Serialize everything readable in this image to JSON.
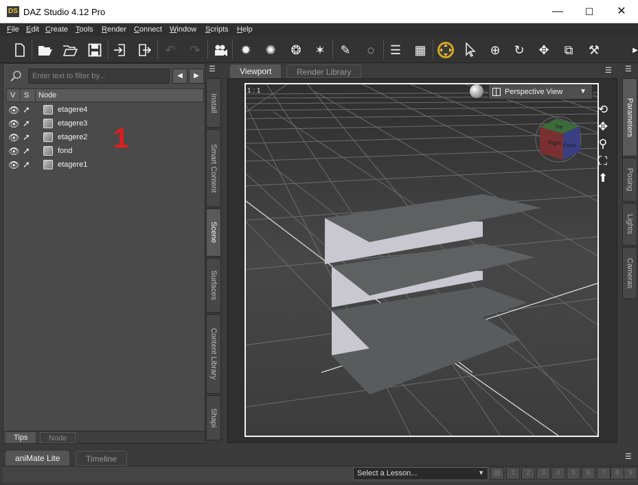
{
  "window": {
    "logo_text": "DS",
    "title": "DAZ Studio 4.12 Pro",
    "minimize": "—",
    "maximize": "☐",
    "close": "✕"
  },
  "menu": [
    "File",
    "Edit",
    "Create",
    "Tools",
    "Render",
    "Connect",
    "Window",
    "Scripts",
    "Help"
  ],
  "toolbar": {
    "icons": [
      "new-file-icon",
      "open-file-icon",
      "merge-file-icon",
      "save-icon",
      "import-icon",
      "export-icon",
      "undo-icon",
      "redo-icon",
      "camera-icon",
      "spotlight-icon",
      "point-light-icon",
      "distant-light-icon",
      "render-icon",
      "select-tool-icon",
      "node-select-icon",
      "universal-tool-icon",
      "rotate-tool-icon",
      "translate-tool-icon",
      "scale-tool-icon",
      "joint-editor-icon"
    ]
  },
  "scene_pane": {
    "filter_placeholder": "Enter text to filter by...",
    "columns": {
      "v": "V",
      "s": "S",
      "node": "Node"
    },
    "nodes": [
      "etagere4",
      "etagere3",
      "etagere2",
      "fond",
      "etagere1"
    ],
    "annotation": "1",
    "bottom_tabs": [
      "Tips",
      "Node"
    ]
  },
  "left_vertical_tabs": [
    "Install",
    "Smart Content",
    "Scene",
    "Surfaces",
    "Content Library",
    "Shapi"
  ],
  "viewport": {
    "tabs": [
      "Viewport",
      "Render Library"
    ],
    "ratio": "1 : 1",
    "camera": "Perspective View",
    "cube_top": "Top",
    "cube_front": "Front",
    "cube_side": "Right"
  },
  "right_vertical_tabs": [
    "Parameters",
    "Posing",
    "Lights",
    "Cameras"
  ],
  "bottom": {
    "tabs": [
      "aniMate Lite",
      "Timeline"
    ],
    "lesson_placeholder": "Select a Lesson...",
    "steps": [
      "1",
      "2",
      "3",
      "4",
      "5",
      "6",
      "7",
      "8",
      "9"
    ]
  },
  "colors": {
    "annotation_red": "#e31d1d",
    "viewport_border": "#f4f4f4",
    "background": "#3b3b3b"
  }
}
